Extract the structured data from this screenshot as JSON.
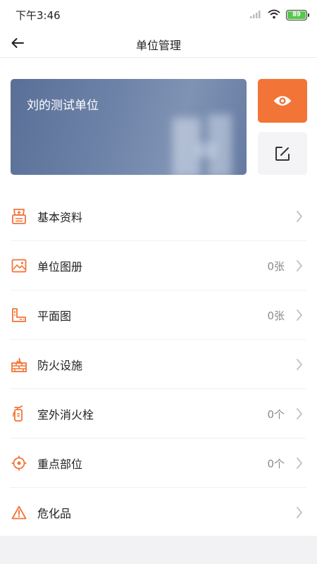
{
  "status_bar": {
    "time": "下午3:46",
    "battery": "89"
  },
  "nav": {
    "title": "单位管理"
  },
  "unit_card": {
    "name": "刘的测试单位"
  },
  "menu": [
    {
      "label": "基本资料",
      "value": "",
      "icon": "profile-doc-icon"
    },
    {
      "label": "单位图册",
      "value": "0张",
      "icon": "image-album-icon"
    },
    {
      "label": "平面图",
      "value": "0张",
      "icon": "floor-plan-icon"
    },
    {
      "label": "防火设施",
      "value": "",
      "icon": "firewall-icon"
    },
    {
      "label": "室外消火栓",
      "value": "0个",
      "icon": "fire-extinguisher-icon"
    },
    {
      "label": "重点部位",
      "value": "0个",
      "icon": "target-location-icon"
    },
    {
      "label": "危化品",
      "value": "",
      "icon": "warning-triangle-icon"
    }
  ],
  "colors": {
    "accent": "#f27437",
    "card": "#6a7fa5",
    "text": "#222222",
    "muted": "#8a8a8a"
  }
}
